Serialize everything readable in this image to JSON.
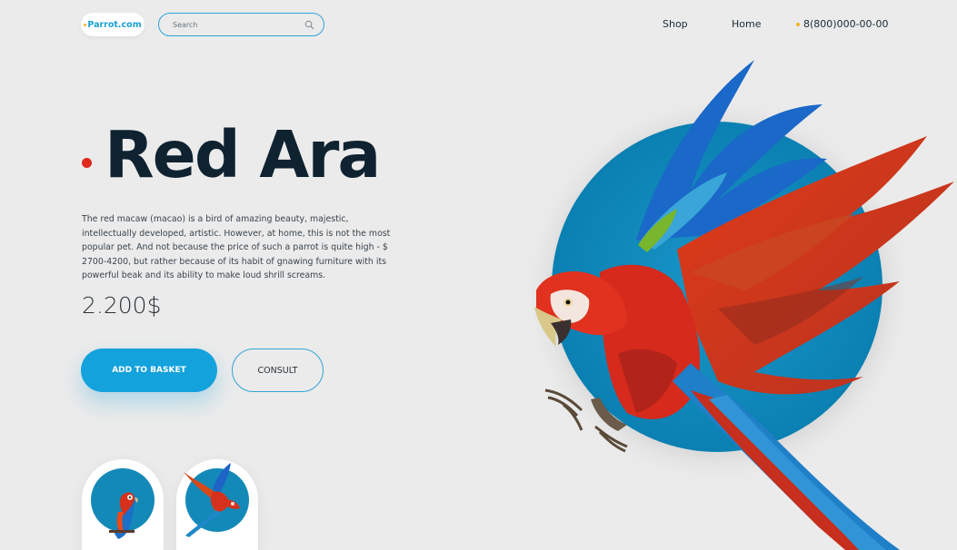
{
  "header": {
    "logo": "Parrot.com",
    "search": {
      "placeholder": "Search",
      "value": ""
    },
    "nav": [
      {
        "label": "Shop"
      },
      {
        "label": "Home"
      }
    ],
    "phone": "8(800)000-00-00"
  },
  "product": {
    "title": "Red Ara",
    "description": "The red macaw (macao) is a bird of amazing beauty, majestic, intellectually developed, artistic. However, at home, this is not the most popular pet. And not because the price of such a parrot is quite high - $ 2700-4200, but rather because of its habit of gnawing furniture with its powerful beak and its ability to make loud shrill screams.",
    "price": "2.200$",
    "add_to_basket": "ADD TO BASKET",
    "consult": "CONSULT"
  },
  "thumbnails": [
    {
      "icon": "perched-macaw-photo"
    },
    {
      "icon": "flying-macaw-photo"
    }
  ],
  "colors": {
    "accent": "#14a2dc",
    "circle": "#1389b8",
    "title_dot": "#e0281d",
    "phone_dot": "#f0b428",
    "background": "#ebebeb"
  }
}
